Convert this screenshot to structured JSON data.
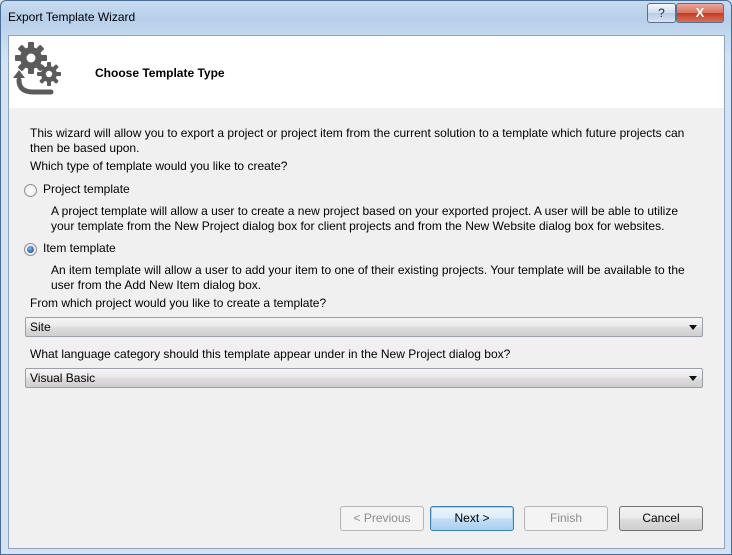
{
  "window": {
    "title": "Export Template Wizard",
    "help_label": "?",
    "close_label": "X"
  },
  "header": {
    "title": "Choose Template Type",
    "icon": "gears-arrow-icon"
  },
  "intro": {
    "line1": "This wizard will allow you to export a project or project item from the current solution to a template which future projects can",
    "line2": "then be based upon."
  },
  "question_type": "Which type of template would you like to create?",
  "options": [
    {
      "label": "Project template",
      "checked": false,
      "desc1": "A project template will allow a user to create a new project based on your exported project. A user will be able to utilize",
      "desc2": "your template from the New Project dialog box for client projects and from the New Website dialog box for websites."
    },
    {
      "label": "Item template",
      "checked": true,
      "desc1": "An item template will allow a user to add your item to one of their existing projects. Your template will be available to the",
      "desc2": "user from the Add New Item dialog box."
    }
  ],
  "project_question": "From which project would you like to create a template?",
  "project_value": "Site",
  "language_question": "What language category should this template appear under in the New Project dialog box?",
  "language_value": "Visual Basic",
  "buttons": {
    "previous": "< Previous",
    "next": "Next >",
    "finish": "Finish",
    "cancel": "Cancel"
  }
}
